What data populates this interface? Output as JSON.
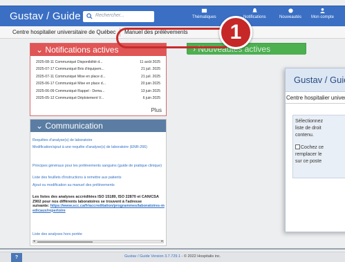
{
  "app": {
    "title": "Gustav / Guide"
  },
  "search": {
    "placeholder": "Rechercher..."
  },
  "nav": [
    {
      "label": "Thématiques",
      "icon": "folder-icon"
    },
    {
      "label": "Notifications",
      "icon": "bell-icon"
    },
    {
      "label": "Nouveautés",
      "icon": "star-icon"
    },
    {
      "label": "Mon compte",
      "icon": "user-icon"
    }
  ],
  "breadcrumb": {
    "root": "Centre hospitalier universitaire de Québec",
    "current": "Manuel des prélèvements"
  },
  "callout": {
    "number": "1"
  },
  "notifications": {
    "title": "Notifications actives",
    "rows": [
      {
        "text": "2025-08-11 Communiqué Disponibilité d...",
        "date": "11 août 2025"
      },
      {
        "text": "2025-07-17 Communiqué Bris d'équipem...",
        "date": "21 juil. 2025"
      },
      {
        "text": "2025-07-11 Communiqué Mise en place d...",
        "date": "21 juil. 2025"
      },
      {
        "text": "2025-06-17 Communiqué Mise en place d...",
        "date": "20 juin 2025"
      },
      {
        "text": "2025-06-09 Communiqué Rappel - Dema...",
        "date": "13 juin 2025"
      },
      {
        "text": "2025-05-12 Communiqué Déploiement V...",
        "date": "6 juin 2025"
      }
    ],
    "more": "Plus"
  },
  "nouveautes": {
    "title": "Nouveautés actives"
  },
  "communication": {
    "title": "Communication",
    "links": [
      "Requêtes d'analyse(s) de laboratoire",
      "Modification/ajout à une requête d'analyse(s) de laboratoire (ENR-266)",
      "Principes généraux pour les prélèvements sanguins (guide de pratique clinique)",
      "Liste des feuillets d'instructions à remettre aux patients",
      "Ajout ou modification au manuel des prélèvements"
    ],
    "note_text": "Les listes des analyses accréditées ISO 15189, ISO 22870 et CAN/CSA Z902 pour nos différents laboratoires se trouvent à l'adresse",
    "note_prefix": "suivante:",
    "note_url": "https://www.scc.ca/fr/accreditation/programmes/laboratoires-medicaux/repertoire",
    "last_link": "Liste des analyses hors portée"
  },
  "dialog": {
    "title": "Gustav / Guide",
    "subtitle": "Centre hospitalier universitaire de Québec",
    "lines": [
      "Sélectionnez",
      "liste de droit",
      "contenu."
    ],
    "checkbox_lines": [
      "Cochez ce",
      "remplacer le",
      "sur ce poste"
    ]
  },
  "footer": {
    "app": "Gustav / Guide",
    "version": "Version 3.7.729.1",
    "copyright": "- © 2022 Hospitalis inc."
  },
  "help": {
    "label": "?"
  },
  "colors": {
    "topbar": "#3a6fc4",
    "notif": "#e05555",
    "nouv": "#4caf50",
    "comm": "#5b7da3",
    "callout": "#c62828"
  }
}
